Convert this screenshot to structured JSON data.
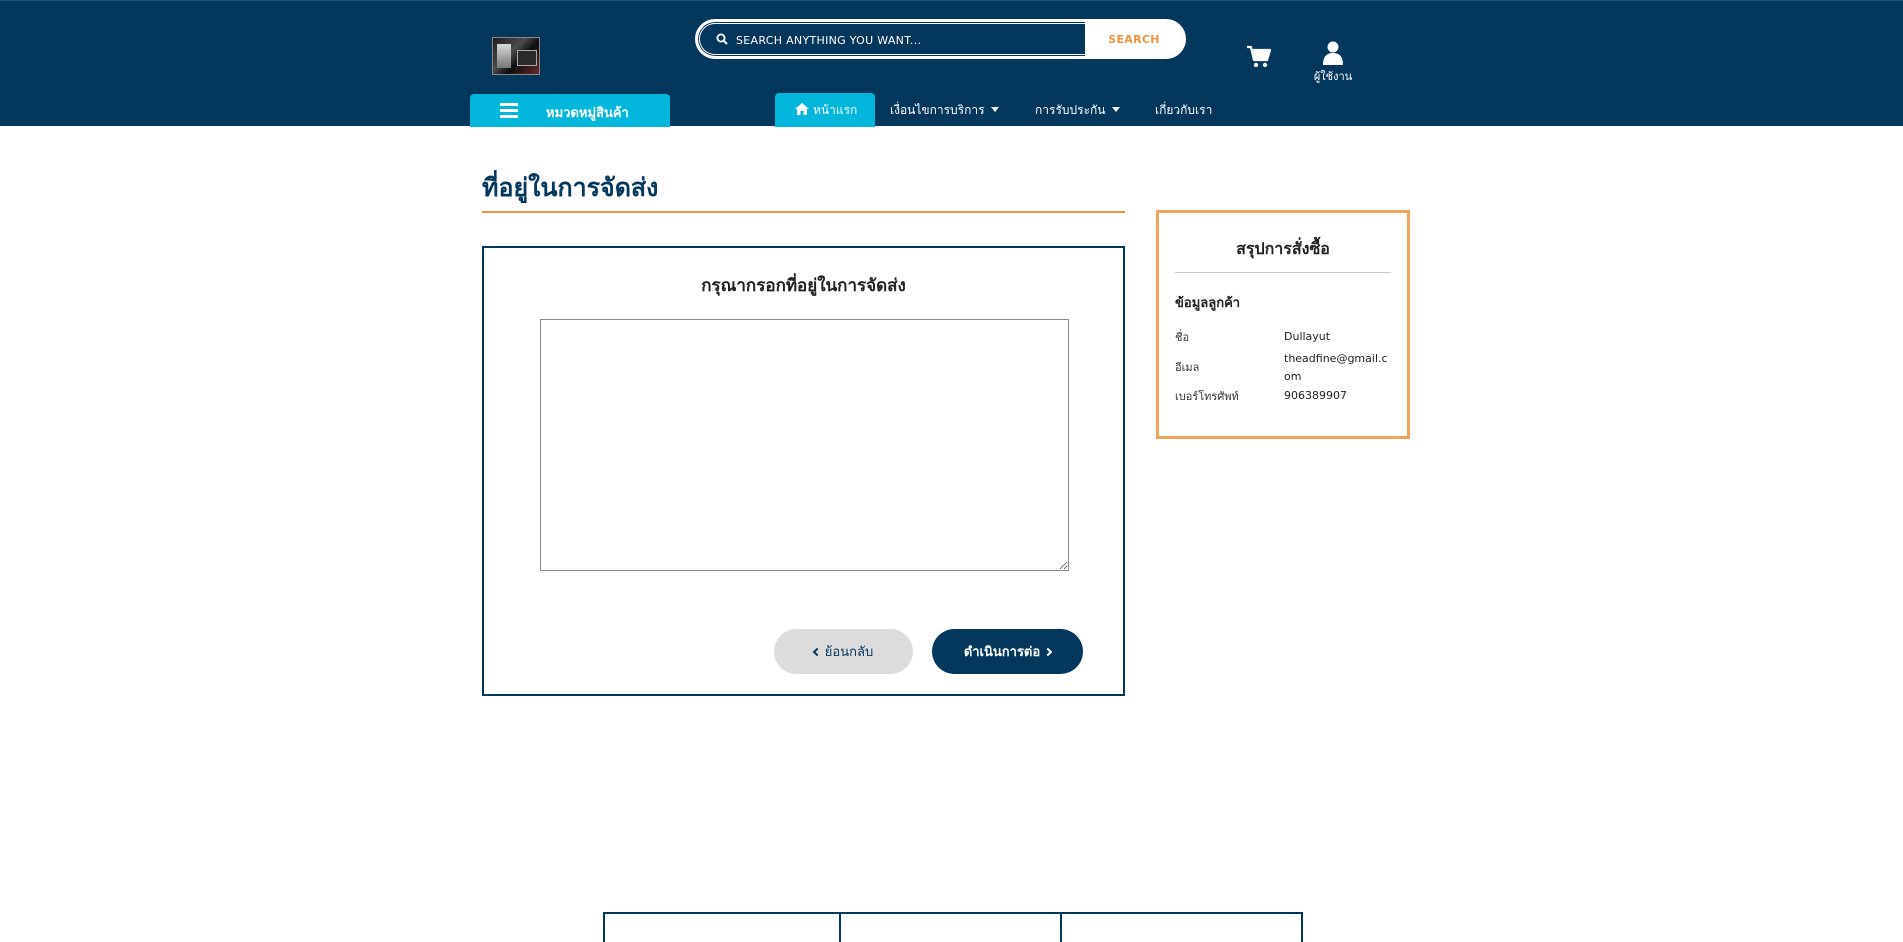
{
  "header": {
    "search": {
      "placeholder": "SEARCH ANYTHING YOU WANT...",
      "button_label": "SEARCH"
    },
    "user_label": "ผู้ใช้งาน",
    "category_label": "หมวดหมู่สินค้า",
    "nav": {
      "home": "หน้าแรก",
      "terms": "เงื่อนไขการบริการ",
      "warranty": "การรับประกัน",
      "about": "เกี่ยวกับเรา"
    }
  },
  "main": {
    "page_title": "ที่อยู่ในการจัดส่ง",
    "card_heading": "กรุณากรอกที่อยู่ในการจัดส่ง",
    "address_value": "",
    "back_label": "ย้อนกลับ",
    "next_label": "ดำเนินการต่อ"
  },
  "summary": {
    "title": "สรุปการสั่งซื้อ",
    "customer_heading": "ข้อมูลลูกค้า",
    "rows": [
      {
        "label": "ชื่อ",
        "value": "Dullayut"
      },
      {
        "label": "อีเมล",
        "value": "theadfine@gmail.com"
      },
      {
        "label": "เบอร์โทรศัพท์",
        "value": "906389907"
      }
    ]
  },
  "icons": {
    "search": "search-icon",
    "cart": "cart-icon",
    "user": "user-icon",
    "menu": "menu-icon",
    "home": "home-icon"
  },
  "colors": {
    "navy": "#03375c",
    "cyan": "#03b6dc",
    "orange": "#f0923e"
  }
}
